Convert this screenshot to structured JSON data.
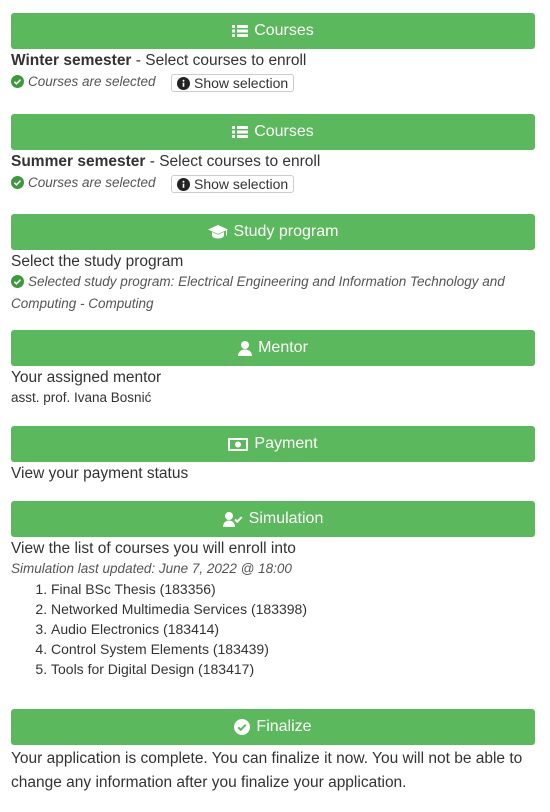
{
  "winter": {
    "header": "Courses",
    "term": "Winter semester",
    "desc_rest": " - Select courses to enroll",
    "status": "Courses are selected",
    "button": "Show selection"
  },
  "summer": {
    "header": "Courses",
    "term": "Summer semester",
    "desc_rest": " - Select courses to enroll",
    "status": "Courses are selected",
    "button": "Show selection"
  },
  "study": {
    "header": "Study program",
    "desc": "Select the study program",
    "status": "Selected study program: Electrical Engineering and Information Technology and Computing - Computing"
  },
  "mentor": {
    "header": "Mentor",
    "desc": "Your assigned mentor",
    "name": "asst. prof. Ivana Bosnić"
  },
  "payment": {
    "header": "Payment",
    "desc": "View your payment status"
  },
  "simulation": {
    "header": "Simulation",
    "desc": "View the list of courses you will enroll into",
    "updated": "Simulation last updated: June 7, 2022 @ 18:00",
    "courses": [
      "Final BSc Thesis (183356)",
      "Networked Multimedia Services (183398)",
      "Audio Electronics (183414)",
      "Control System Elements (183439)",
      "Tools for Digital Design (183417)"
    ]
  },
  "finalize": {
    "header": "Finalize",
    "desc": "Your application is complete. You can finalize it now. You will not be able to change any information after you finalize your application."
  },
  "colors": {
    "accent": "#5cb85c",
    "text": "#333333"
  }
}
